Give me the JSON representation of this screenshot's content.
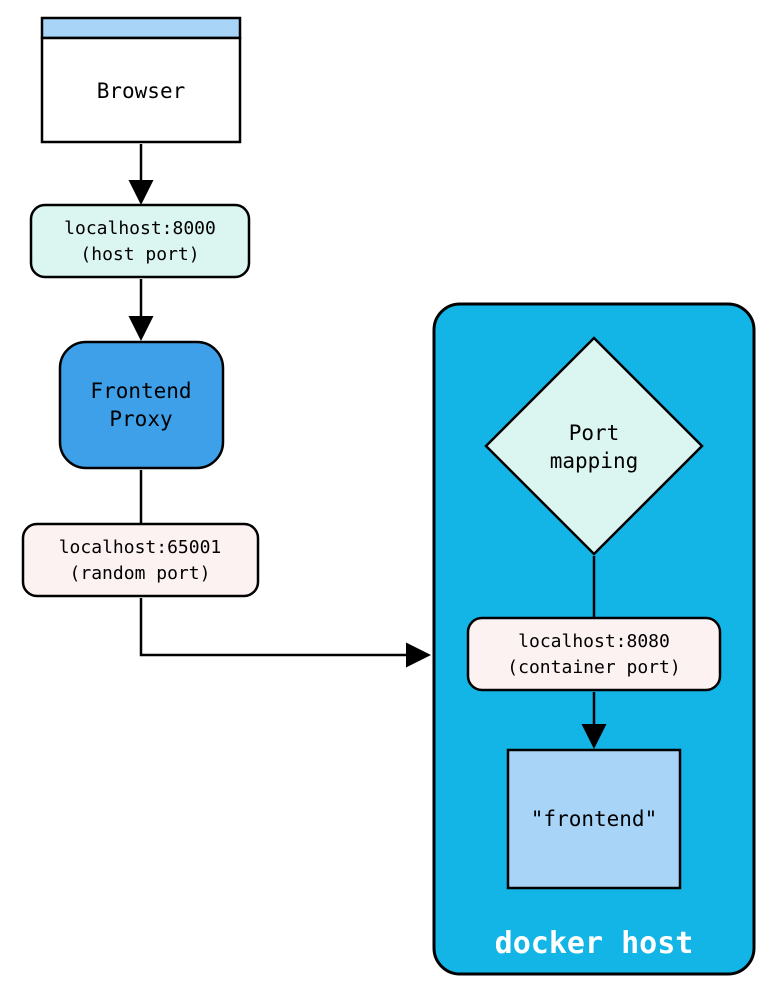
{
  "browser_label": "Browser",
  "host_port_code": "localhost:8000",
  "host_port_sub": "(host port)",
  "frontend_proxy_line1": "Frontend",
  "frontend_proxy_line2": "Proxy",
  "random_port_code": "localhost:65001",
  "random_port_sub": "(random port)",
  "docker_host_label": "docker host",
  "port_mapping_line1": "Port",
  "port_mapping_line2": "mapping",
  "container_port_code": "localhost:8080",
  "container_port_sub": "(container port)",
  "frontend_container_label": "\"frontend\"",
  "colors": {
    "browser_header": "#a8d5f7",
    "pill_cyan_fill": "#dbf5f0",
    "pill_pink_fill": "#fdf2f2",
    "proxy_fill": "#3da0e8",
    "docker_fill": "#12b5e5",
    "diamond_fill": "#dbf5f0",
    "frontend_fill": "#a8d5f7",
    "stroke": "#000000"
  }
}
